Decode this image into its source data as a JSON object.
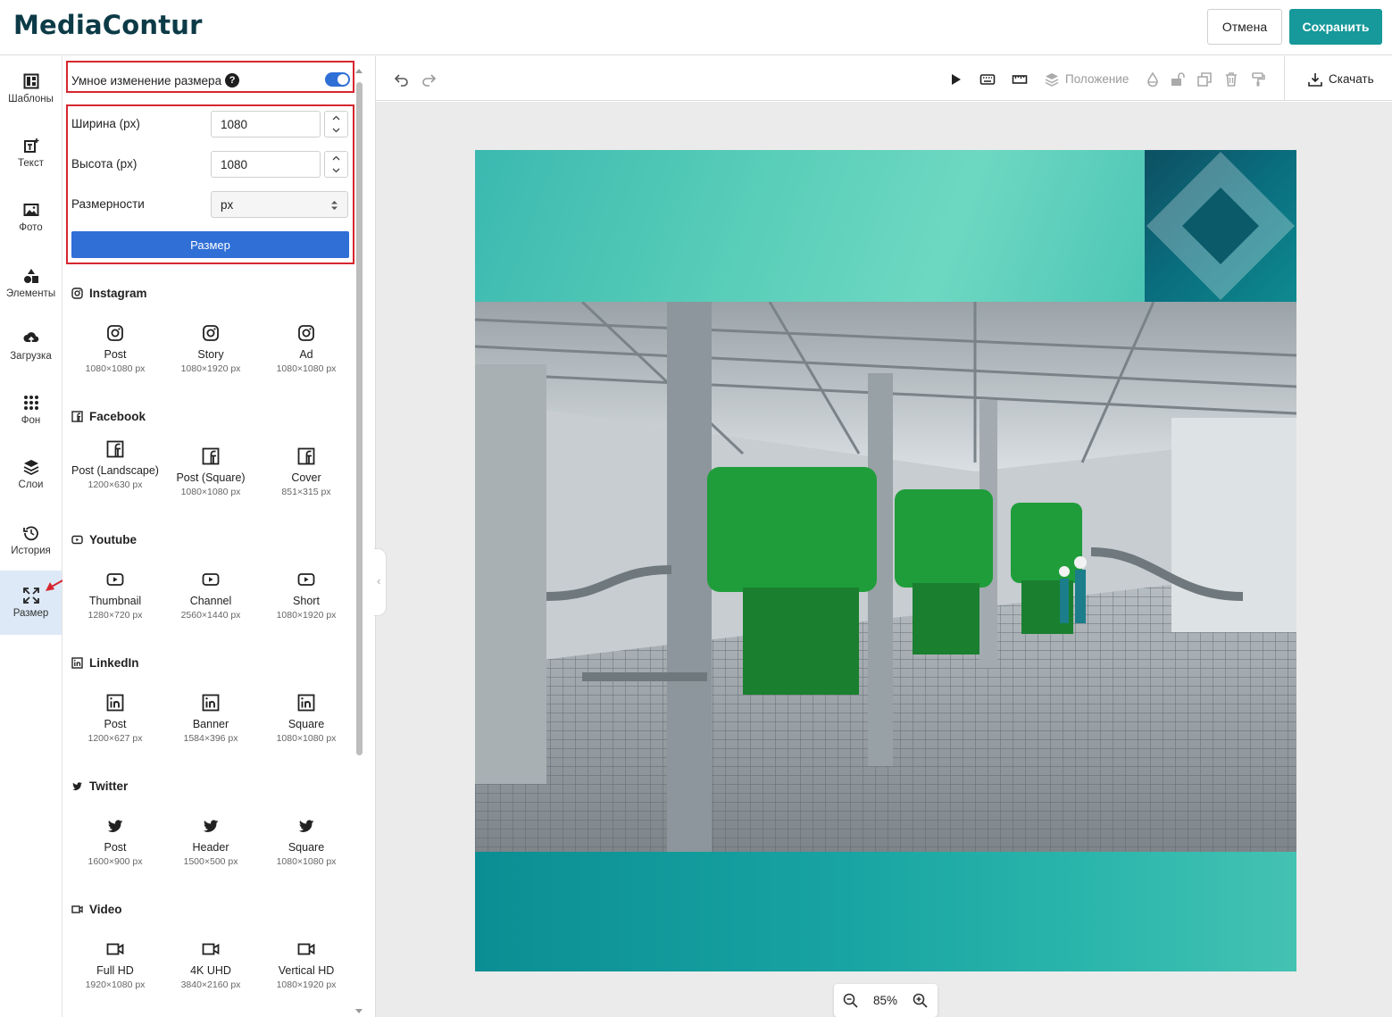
{
  "header": {
    "logo": "MediaContur",
    "cancel_label": "Отмена",
    "save_label": "Сохранить"
  },
  "rail": {
    "items": [
      {
        "label": "Шаблоны",
        "icon": "templates-icon"
      },
      {
        "label": "Текст",
        "icon": "text-icon"
      },
      {
        "label": "Фото",
        "icon": "photo-icon"
      },
      {
        "label": "Элементы",
        "icon": "elements-icon"
      },
      {
        "label": "Загрузка",
        "icon": "upload-icon"
      },
      {
        "label": "Фон",
        "icon": "background-grid-icon"
      },
      {
        "label": "Слои",
        "icon": "layers-icon"
      },
      {
        "label": "История",
        "icon": "history-icon"
      },
      {
        "label": "Размер",
        "icon": "resize-icon",
        "active": true
      }
    ]
  },
  "resize_panel": {
    "smart_resize_label": "Умное изменение размера",
    "smart_resize_on": true,
    "width_label": "Ширина (px)",
    "width_value": "1080",
    "height_label": "Высота (px)",
    "height_value": "1080",
    "units_label": "Размерности",
    "units_value": "px",
    "apply_label": "Размер"
  },
  "presets": [
    {
      "title": "Instagram",
      "icon": "instagram-icon",
      "items": [
        {
          "name": "Post",
          "size": "1080×1080 px"
        },
        {
          "name": "Story",
          "size": "1080×1920 px"
        },
        {
          "name": "Ad",
          "size": "1080×1080 px"
        }
      ]
    },
    {
      "title": "Facebook",
      "icon": "facebook-icon",
      "items": [
        {
          "name": "Post (Landscape)",
          "size": "1200×630 px"
        },
        {
          "name": "Post (Square)",
          "size": "1080×1080 px"
        },
        {
          "name": "Cover",
          "size": "851×315 px"
        }
      ]
    },
    {
      "title": "Youtube",
      "icon": "youtube-icon",
      "items": [
        {
          "name": "Thumbnail",
          "size": "1280×720 px"
        },
        {
          "name": "Channel",
          "size": "2560×1440 px"
        },
        {
          "name": "Short",
          "size": "1080×1920 px"
        }
      ]
    },
    {
      "title": "LinkedIn",
      "icon": "linkedin-icon",
      "items": [
        {
          "name": "Post",
          "size": "1200×627 px"
        },
        {
          "name": "Banner",
          "size": "1584×396 px"
        },
        {
          "name": "Square",
          "size": "1080×1080 px"
        }
      ]
    },
    {
      "title": "Twitter",
      "icon": "twitter-icon",
      "items": [
        {
          "name": "Post",
          "size": "1600×900 px"
        },
        {
          "name": "Header",
          "size": "1500×500 px"
        },
        {
          "name": "Square",
          "size": "1080×1080 px"
        }
      ]
    },
    {
      "title": "Video",
      "icon": "video-icon",
      "items": [
        {
          "name": "Full HD",
          "size": "1920×1080 px"
        },
        {
          "name": "4K UHD",
          "size": "3840×2160 px"
        },
        {
          "name": "Vertical HD",
          "size": "1080×1920 px"
        }
      ]
    }
  ],
  "toolbar": {
    "position_label": "Положение",
    "download_label": "Скачать"
  },
  "canvas": {
    "zoom": "85%"
  },
  "colors": {
    "brand": "#17989a",
    "accent_blue": "#2f6fd6",
    "highlight_red": "#d6262f"
  }
}
